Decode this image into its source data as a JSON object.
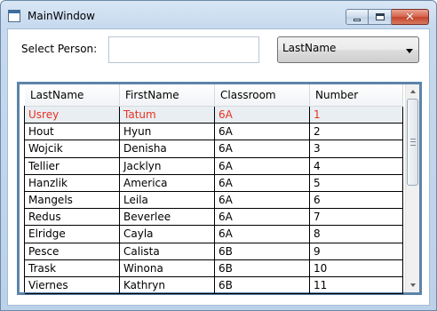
{
  "window": {
    "title": "MainWindow"
  },
  "controls": {
    "select_person_label": "Select Person:",
    "person_input_value": "",
    "sort_combo_value": "LastName"
  },
  "grid": {
    "columns": [
      "LastName",
      "FirstName",
      "Classroom",
      "Number"
    ],
    "selected_row_index": 0,
    "rows": [
      [
        "Usrey",
        "Tatum",
        "6A",
        "1"
      ],
      [
        "Hout",
        "Hyun",
        "6A",
        "2"
      ],
      [
        "Wojcik",
        "Denisha",
        "6A",
        "3"
      ],
      [
        "Tellier",
        "Jacklyn",
        "6A",
        "4"
      ],
      [
        "Hanzlik",
        "America",
        "6A",
        "5"
      ],
      [
        "Mangels",
        "Leila",
        "6A",
        "6"
      ],
      [
        "Redus",
        "Beverlee",
        "6A",
        "7"
      ],
      [
        "Elridge",
        "Cayla",
        "6A",
        "8"
      ],
      [
        "Pesce",
        "Calista",
        "6B",
        "9"
      ],
      [
        "Trask",
        "Winona",
        "6B",
        "10"
      ],
      [
        "Viernes",
        "Kathryn",
        "6B",
        "11"
      ]
    ]
  },
  "colors": {
    "selected_text": "#e8321f",
    "frame_border": "#5c84a9"
  }
}
